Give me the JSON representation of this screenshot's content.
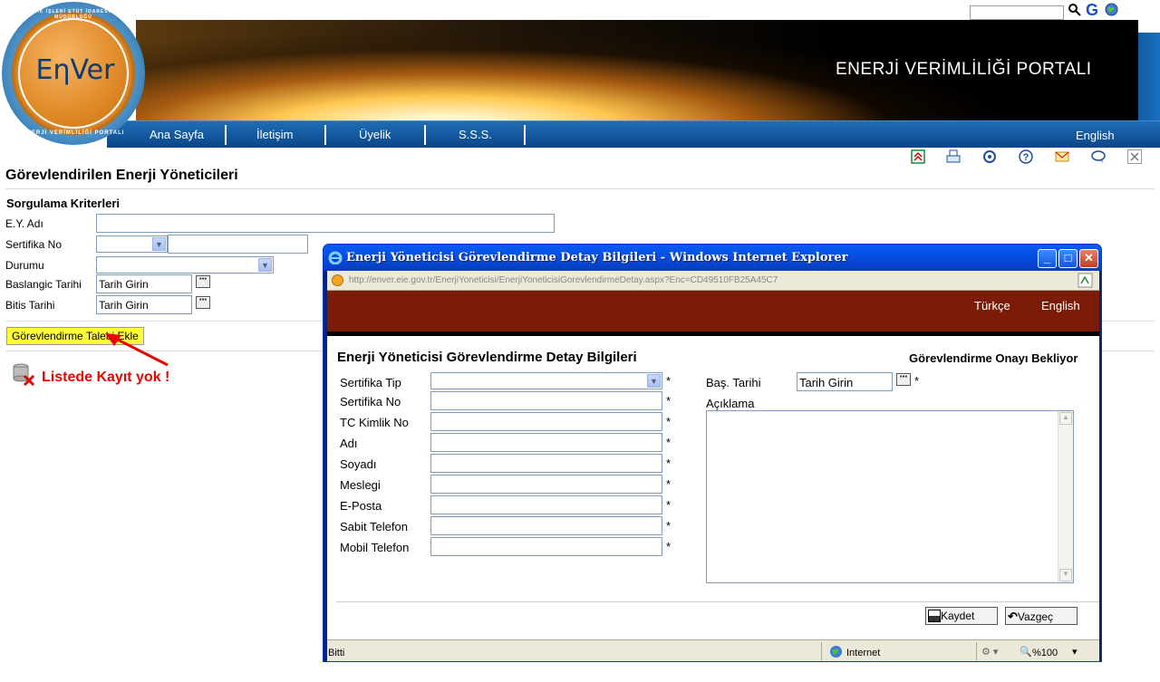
{
  "header": {
    "logo_text": "EηVer",
    "logo_ring_top": "ELEKTRİK İŞLERİ ETÜT İDARESİ GENEL MÜDÜRLÜĞÜ",
    "logo_ring_bottom": "ENERJİ VERİMLİLİĞİ PORTALI",
    "portal_title": "ENERJİ VERİMLİLİĞİ PORTALI",
    "nav": [
      "Ana Sayfa",
      "İletişim",
      "Üyelik",
      "S.S.S."
    ],
    "lang_link": "English"
  },
  "page": {
    "title": "Görevlendirilen Enerji Yöneticileri",
    "criteria_title": "Sorgulama Kriterleri",
    "labels": {
      "ey_adi": "E.Y. Adı",
      "sertifika_no": "Sertifika No",
      "durumu": "Durumu",
      "baslangic": "Baslangic Tarihi",
      "bitis": "Bitis Tarihi"
    },
    "date_placeholder": "Tarih Girin",
    "add_button": "Görevlendirme Talebi Ekle",
    "no_records": "Listede Kayıt yok  !"
  },
  "popup": {
    "window_title": "Enerji Yöneticisi Görevlendirme Detay Bilgileri - Windows Internet Explorer",
    "address": "http://enver.eie.gov.tr/EnerjiYoneticisi/EnerjiYoneticisiGorevlendirmeDetay.aspx?Enc=CD49510FB25A45C7",
    "langs": [
      "Türkçe",
      "English"
    ],
    "form_title": "Enerji Yöneticisi Görevlendirme Detay Bilgileri",
    "form_status": "Görevlendirme Onayı Bekliyor",
    "fields": [
      "Sertifika Tip",
      "Sertifika No",
      "TC Kimlik No",
      "Adı",
      "Soyadı",
      "Meslegi",
      "E-Posta",
      "Sabit Telefon",
      "Mobil Telefon"
    ],
    "required_mark": "*",
    "bas_tarihi_label": "Baş. Tarihi",
    "bas_tarihi_value": "Tarih Girin",
    "aciklama_label": "Açıklama",
    "save_button": "Kaydet",
    "cancel_button": "Vazgeç",
    "status_left": "Bitti",
    "status_zone": "Internet",
    "zoom": "%100"
  },
  "colors": {
    "nav_blue": "#0b4688",
    "popup_header": "#7a1c06",
    "highlight_button": "#ffff33",
    "error_text": "#ee0000"
  }
}
